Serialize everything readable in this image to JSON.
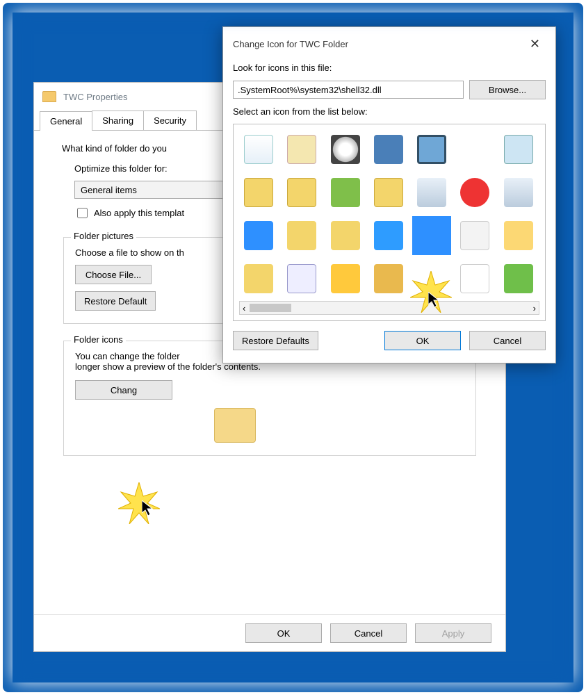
{
  "properties_window": {
    "title": "TWC Properties",
    "tabs": [
      "General",
      "Sharing",
      "Security"
    ],
    "question": "What kind of folder do you",
    "optimize_label": "Optimize this folder for:",
    "optimize_value": "General items",
    "also_apply_label": "Also apply this templat",
    "folder_pictures_legend": "Folder pictures",
    "choose_file_hint": "Choose a file to show on th",
    "choose_file_btn": "Choose File...",
    "restore_default_btn": "Restore Default",
    "folder_icons_legend": "Folder icons",
    "folder_icons_text1": "You can change the folder",
    "folder_icons_text2": "longer show a preview of the folder's contents.",
    "change_icon_btn": "Chang",
    "ok": "OK",
    "cancel": "Cancel",
    "apply": "Apply"
  },
  "change_icon_dialog": {
    "title": "Change Icon for TWC Folder",
    "look_label": "Look for icons in this file:",
    "path_value": ".SystemRoot%\\system32\\shell32.dll",
    "browse": "Browse...",
    "select_label": "Select an icon from the list below:",
    "restore_defaults": "Restore Defaults",
    "ok": "OK",
    "cancel": "Cancel",
    "icons": [
      "recycle-bin",
      "control-panel",
      "disc-drive",
      "key",
      "monitor-run",
      "blank",
      "magnifier-globe",
      "folder-pictures",
      "folder-drive",
      "tree",
      "folder-up",
      "drive-help",
      "help",
      "id-card",
      "desktop",
      "folder-fonts",
      "folder-computer",
      "refresh",
      "selected-blank",
      "documents-stack",
      "fax-printer",
      "folder-tools",
      "checklist",
      "star-favorite",
      "padlock",
      "blank2",
      "search-page",
      "printer-add"
    ],
    "selected_index": 18
  }
}
